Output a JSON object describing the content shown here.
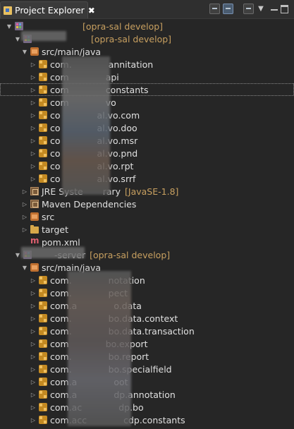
{
  "view": {
    "tab_label": "Project Explorer",
    "close_glyph": "✖"
  },
  "toolbar": {
    "menu_glyph": "▼"
  },
  "rows": [
    {
      "indent": 8,
      "arrow": "▼",
      "icon": "project",
      "name": "",
      "decor": "[opra-sal develop]"
    },
    {
      "indent": 20,
      "arrow": "▼",
      "icon": "project",
      "name": "",
      "decor": "[opra-sal develop]"
    },
    {
      "indent": 30,
      "arrow": "▼",
      "icon": "srcfolder",
      "name": "src/main/java",
      "decor": ""
    },
    {
      "indent": 42,
      "arrow": "▷",
      "icon": "pkg",
      "name": "com.",
      "tail": "annitation"
    },
    {
      "indent": 42,
      "arrow": "▷",
      "icon": "pkg",
      "name": "com",
      "tail": "api"
    },
    {
      "indent": 42,
      "arrow": "▷",
      "icon": "pkg",
      "name": "com",
      "tail": "constants",
      "selected": true
    },
    {
      "indent": 42,
      "arrow": "▷",
      "icon": "pkg",
      "name": "com",
      "tail": "vo"
    },
    {
      "indent": 42,
      "arrow": "▷",
      "icon": "pkg",
      "name": "co",
      "tail": "al.vo.com"
    },
    {
      "indent": 42,
      "arrow": "▷",
      "icon": "pkg",
      "name": "co",
      "tail": "al.vo.doo"
    },
    {
      "indent": 42,
      "arrow": "▷",
      "icon": "pkg",
      "name": "co",
      "tail": "al.vo.msr"
    },
    {
      "indent": 42,
      "arrow": "▷",
      "icon": "pkg",
      "name": "co",
      "tail": "al.vo.pnd"
    },
    {
      "indent": 42,
      "arrow": "▷",
      "icon": "pkg",
      "name": "co",
      "tail": "al.vo.rpt"
    },
    {
      "indent": 42,
      "arrow": "▷",
      "icon": "pkg",
      "name": "co",
      "tail": "al.vo.srrf"
    },
    {
      "indent": 30,
      "arrow": "▷",
      "icon": "library",
      "name": "JRE Syste",
      "tail": "rary",
      "decor": "[JavaSE-1.8]"
    },
    {
      "indent": 30,
      "arrow": "▷",
      "icon": "library",
      "name": "Maven Dependencies"
    },
    {
      "indent": 30,
      "arrow": "▷",
      "icon": "srcfolder",
      "name": "src"
    },
    {
      "indent": 30,
      "arrow": "▷",
      "icon": "folder",
      "name": "target"
    },
    {
      "indent": 30,
      "arrow": "",
      "icon": "pom",
      "name": "pom.xml"
    },
    {
      "indent": 20,
      "arrow": "▼",
      "icon": "project",
      "name": "",
      "tail": "-server",
      "decor": "[opra-sal develop]"
    },
    {
      "indent": 30,
      "arrow": "▼",
      "icon": "srcfolder",
      "name": "src/main/java"
    },
    {
      "indent": 42,
      "arrow": "▷",
      "icon": "pkg",
      "name": "com.",
      "tail": "notation"
    },
    {
      "indent": 42,
      "arrow": "▷",
      "icon": "pkg",
      "name": "com.",
      "tail": "pect"
    },
    {
      "indent": 42,
      "arrow": "▷",
      "icon": "pkg",
      "name": "com.a",
      "tail": "o.data"
    },
    {
      "indent": 42,
      "arrow": "▷",
      "icon": "pkg",
      "name": "com.",
      "tail": "bo.data.context"
    },
    {
      "indent": 42,
      "arrow": "▷",
      "icon": "pkg",
      "name": "com.",
      "tail": "bo.data.transaction"
    },
    {
      "indent": 42,
      "arrow": "▷",
      "icon": "pkg",
      "name": "com",
      "tail": "bo.export"
    },
    {
      "indent": 42,
      "arrow": "▷",
      "icon": "pkg",
      "name": "com.",
      "tail": "bo.report"
    },
    {
      "indent": 42,
      "arrow": "▷",
      "icon": "pkg",
      "name": "com.",
      "tail": "bo.specialfield"
    },
    {
      "indent": 42,
      "arrow": "▷",
      "icon": "pkg",
      "name": "com.a",
      "tail": "oot"
    },
    {
      "indent": 42,
      "arrow": "▷",
      "icon": "pkg",
      "name": "com.a",
      "tail": "dp.annotation"
    },
    {
      "indent": 42,
      "arrow": "▷",
      "icon": "pkg",
      "name": "com.ac",
      "tail": "dp.bo"
    },
    {
      "indent": 42,
      "arrow": "▷",
      "icon": "pkg",
      "name": "com.acc",
      "tail": "cdp.constants"
    }
  ]
}
